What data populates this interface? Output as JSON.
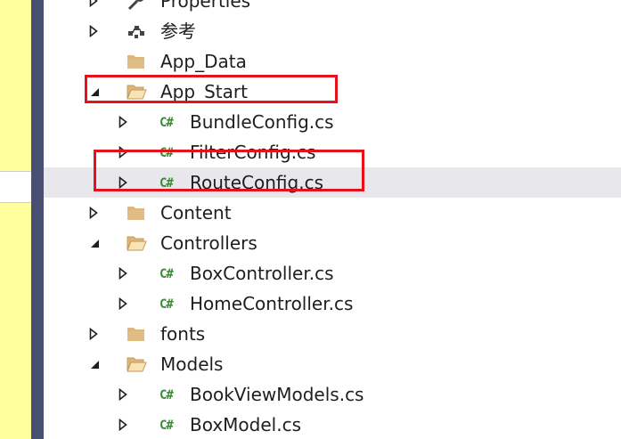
{
  "tree": {
    "items": [
      {
        "label": "Properties",
        "icon": "wrench-icon",
        "expander": "collapsed"
      },
      {
        "label": "参考",
        "icon": "references-icon",
        "expander": "collapsed"
      },
      {
        "label": "App_Data",
        "icon": "folder-icon",
        "expander": "none"
      },
      {
        "label": "App_Start",
        "icon": "open-folder-icon",
        "expander": "expanded"
      },
      {
        "label": "BundleConfig.cs",
        "icon": "csharp-file-icon",
        "expander": "collapsed"
      },
      {
        "label": "FilterConfig.cs",
        "icon": "csharp-file-icon",
        "expander": "collapsed"
      },
      {
        "label": "RouteConfig.cs",
        "icon": "csharp-file-icon",
        "expander": "collapsed",
        "selected": true
      },
      {
        "label": "Content",
        "icon": "folder-icon",
        "expander": "collapsed"
      },
      {
        "label": "Controllers",
        "icon": "open-folder-icon",
        "expander": "expanded"
      },
      {
        "label": "BoxController.cs",
        "icon": "csharp-file-icon",
        "expander": "collapsed"
      },
      {
        "label": "HomeController.cs",
        "icon": "csharp-file-icon",
        "expander": "collapsed"
      },
      {
        "label": "fonts",
        "icon": "folder-icon",
        "expander": "collapsed"
      },
      {
        "label": "Models",
        "icon": "open-folder-icon",
        "expander": "expanded"
      },
      {
        "label": "BookViewModels.cs",
        "icon": "csharp-file-icon",
        "expander": "collapsed"
      },
      {
        "label": "BoxModel.cs",
        "icon": "csharp-file-icon",
        "expander": "collapsed"
      }
    ],
    "csharp_glyph": "C#"
  },
  "colors": {
    "folder": "#dcb67a",
    "csharp": "#388a34",
    "highlight_box": "#e8111b",
    "selection": "#e8e8ec",
    "editor_background": "#ffff9e",
    "divider": "#484f72"
  }
}
